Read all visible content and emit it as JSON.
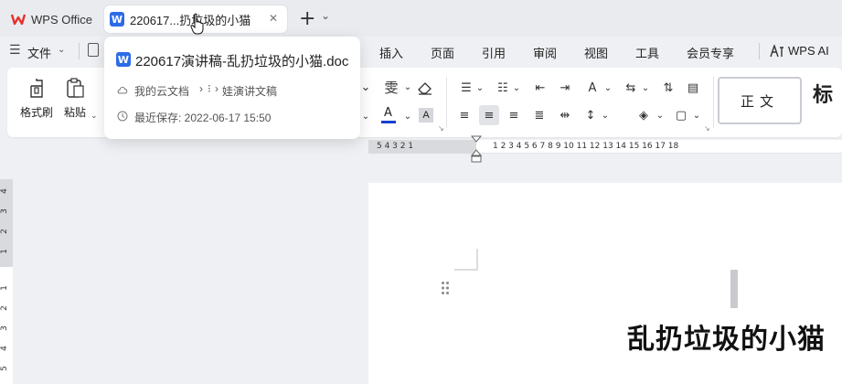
{
  "tabs": {
    "home_label": "WPS Office",
    "doc_label": "220617...扔垃圾的小猫",
    "close_glyph": "✕",
    "new_tab_glyph": "+",
    "new_tab_more": "⌄"
  },
  "menu": {
    "file_label": "文件",
    "insert": "插入",
    "page": "页面",
    "references": "引用",
    "review": "审阅",
    "view": "视图",
    "tools": "工具",
    "member": "会员专享",
    "wps_ai": "WPS AI"
  },
  "toolbar": {
    "format_painter": "格式刷",
    "paste": "粘贴",
    "style_normal": "正文",
    "style_heading": "标"
  },
  "popup": {
    "filename": "220617演讲稿-乱扔垃圾的小猫.doc",
    "path_root": "我的云文档",
    "path_sep": "›",
    "path_folder": "娃演讲文稿",
    "last_saved": "最近保存: 2022-06-17 15:50"
  },
  "ruler": {
    "top_left_nums": "5   4   3   2   1",
    "top_right_nums": "1   2   3   4   5   6   7   8   9  10  11  12  13  14  15  16  17  18"
  },
  "document": {
    "title": "乱扔垃圾的小猫"
  },
  "colors": {
    "accent": "#2d6be8",
    "wps_red": "#e5322d",
    "font_color_bar": "#1a3fd1"
  }
}
